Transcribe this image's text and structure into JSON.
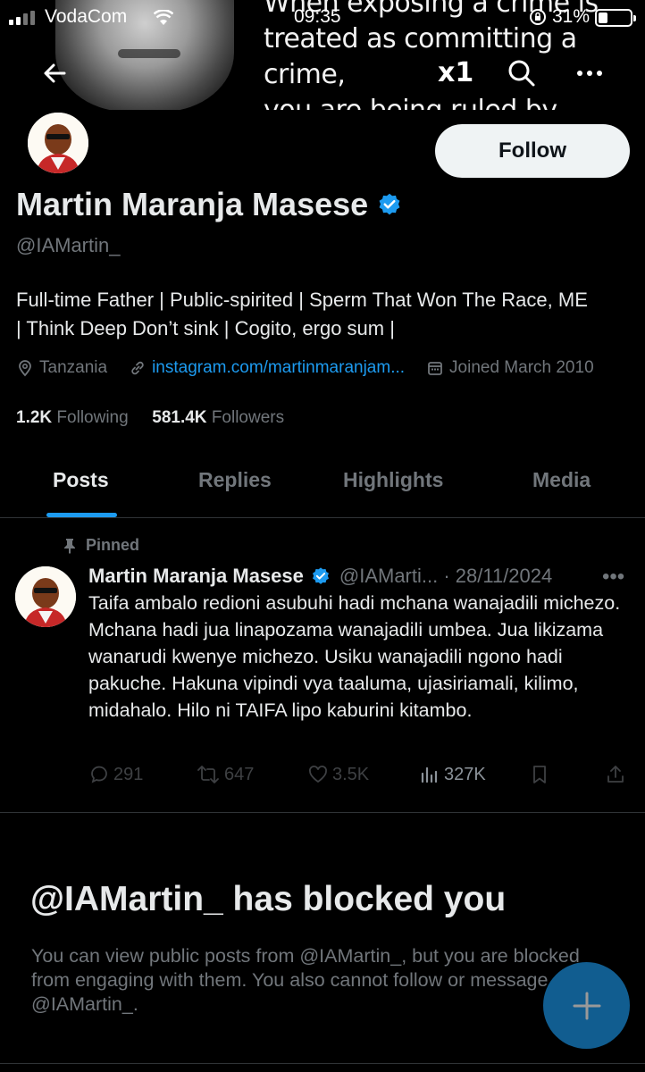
{
  "status_bar": {
    "carrier": "VodaCom",
    "time": "09:35",
    "battery": "31%"
  },
  "banner": {
    "quote_lines": [
      "When exposing a crime is",
      "treated as committing a crime,",
      "you are being ruled by criminals"
    ]
  },
  "nav": {
    "logo_text": "x1"
  },
  "profile": {
    "name": "Martin Maranja Masese",
    "handle": "@IAMartin_",
    "follow_label": "Follow",
    "bio_line1": "Full-time Father | Public-spirited | Sperm That Won The Race, ME",
    "bio_line2": "| Think Deep Don’t sink | Cogito, ergo sum |",
    "location": "Tanzania",
    "website": "instagram.com/martinmaranjam...",
    "joined": "Joined March 2010",
    "following_count": "1.2K",
    "following_label": "Following",
    "followers_count": "581.4K",
    "followers_label": "Followers"
  },
  "tabs": [
    {
      "label": "Posts",
      "active": true
    },
    {
      "label": "Replies",
      "active": false
    },
    {
      "label": "Highlights",
      "active": false
    },
    {
      "label": "Media",
      "active": false
    }
  ],
  "pinned_post": {
    "pinned_label": "Pinned",
    "author": "Martin Maranja Masese",
    "handle_date": "@IAMarti... · 28/11/2024",
    "text": "Taifa ambalo redioni asubuhi hadi mchana wanajadili michezo. Mchana hadi jua linapozama wanajadili umbea. Jua likizama wanarudi kwenye michezo. Usiku wanajadili ngono hadi pakuche. Hakuna vipindi vya taaluma, ujasiriamali, kilimo, midahalo. Hilo ni TAIFA lipo kaburini kitambo.",
    "replies": "291",
    "reposts": "647",
    "likes": "3.5K",
    "views": "327K"
  },
  "blocked": {
    "title": "@IAMartin_ has blocked you",
    "message": "You can view public posts from @IAMartin_, but you are blocked from engaging with them. You also cannot follow or message @IAMartin_."
  },
  "colors": {
    "accent": "#1d9bf0",
    "background": "#000000",
    "text": "#e7e9ea",
    "muted": "#71767b",
    "divider": "#2f3336"
  }
}
